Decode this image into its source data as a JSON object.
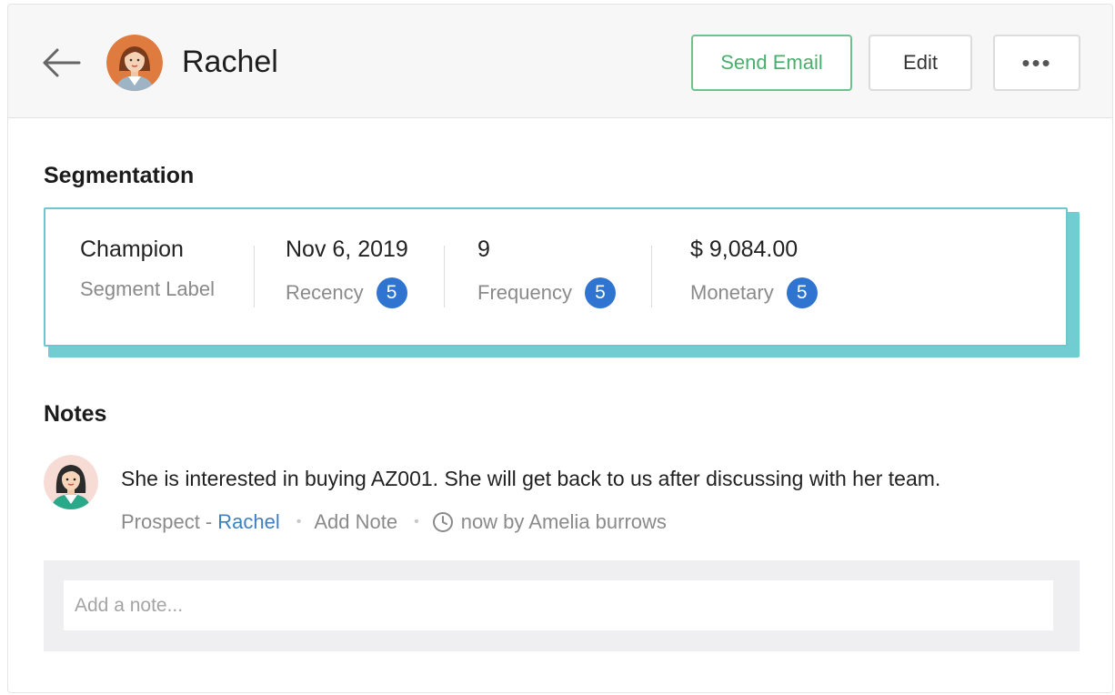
{
  "header": {
    "contact_name": "Rachel",
    "send_email_label": "Send Email",
    "edit_label": "Edit",
    "more_label": "•••"
  },
  "segmentation": {
    "title": "Segmentation",
    "segment": {
      "value": "Champion",
      "label": "Segment Label"
    },
    "recency": {
      "value": "Nov 6, 2019",
      "label": "Recency",
      "score": "5"
    },
    "frequency": {
      "value": "9",
      "label": "Frequency",
      "score": "5"
    },
    "monetary": {
      "value": "$ 9,084.00",
      "label": "Monetary",
      "score": "5"
    }
  },
  "notes": {
    "title": "Notes",
    "items": [
      {
        "text": "She is interested in buying AZ001. She will get back to us after discussing with her team.",
        "context_prefix": "Prospect -",
        "context_link": "Rachel",
        "add_note_label": "Add Note",
        "timestamp": "now by Amelia burrows"
      }
    ],
    "input_placeholder": "Add a note..."
  },
  "colors": {
    "accent_green": "#4aae6e",
    "segment_border": "#6cc8cf",
    "badge_blue": "#2f74d0",
    "link_blue": "#3d7fc0"
  }
}
